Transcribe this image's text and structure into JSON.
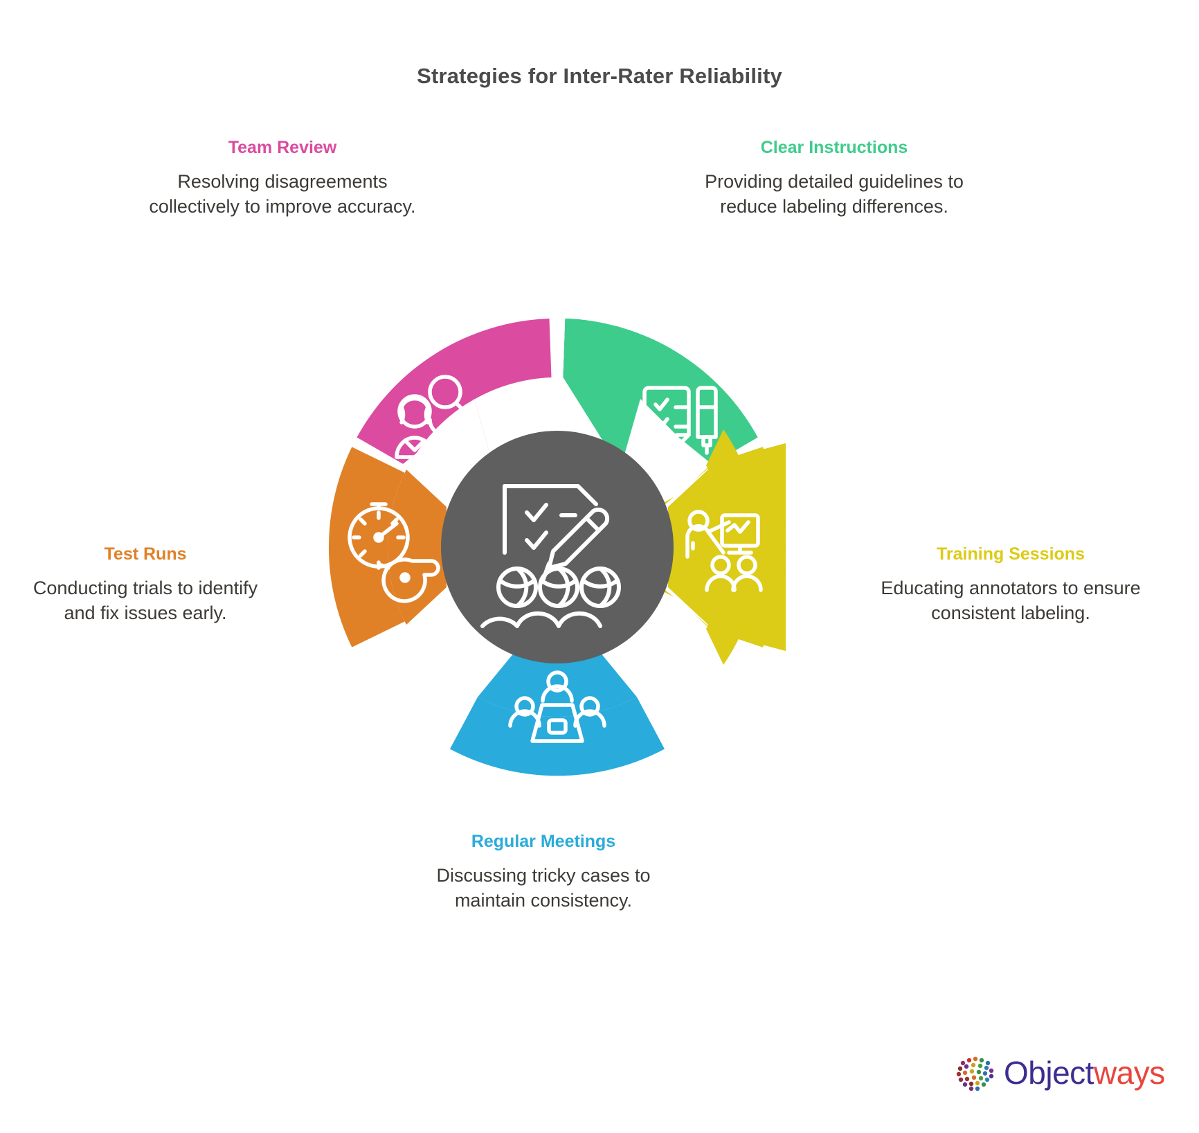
{
  "title": "Strategies for Inter-Rater Reliability",
  "colors": {
    "green": "#3ECC8C",
    "yellow": "#DCCB17",
    "blue": "#29ABDC",
    "orange": "#E08128",
    "pink": "#DB4BA0",
    "center": "#5F5F5F",
    "title_text": "#4b4b4b",
    "body_text": "#3d3a36",
    "logo_object": "#3c2d8f",
    "logo_ways": "#e8453c"
  },
  "segments": [
    {
      "key": "clear_instructions",
      "heading": "Clear Instructions",
      "body": "Providing detailed guidelines to reduce labeling differences.",
      "color": "#3ECC8C",
      "icon": "clipboard-pen-icon"
    },
    {
      "key": "training_sessions",
      "heading": "Training Sessions",
      "body": "Educating annotators to ensure consistent labeling.",
      "color": "#DCCB17",
      "icon": "presenter-board-icon"
    },
    {
      "key": "regular_meetings",
      "heading": "Regular Meetings",
      "body": "Discussing tricky cases to maintain consistency.",
      "color": "#29ABDC",
      "icon": "meeting-table-icon"
    },
    {
      "key": "test_runs",
      "heading": "Test Runs",
      "body": "Conducting trials to identify and fix issues early.",
      "color": "#E08128",
      "icon": "stopwatch-whistle-icon"
    },
    {
      "key": "team_review",
      "heading": "Team Review",
      "body": "Resolving disagreements collectively to improve accuracy.",
      "color": "#DB4BA0",
      "icon": "people-review-icon"
    }
  ],
  "center": {
    "icon": "document-checklist-people-icon",
    "color": "#5F5F5F"
  },
  "logo": {
    "name_first": "Object",
    "name_second": "ways",
    "mark": "dotted-sphere-icon"
  }
}
